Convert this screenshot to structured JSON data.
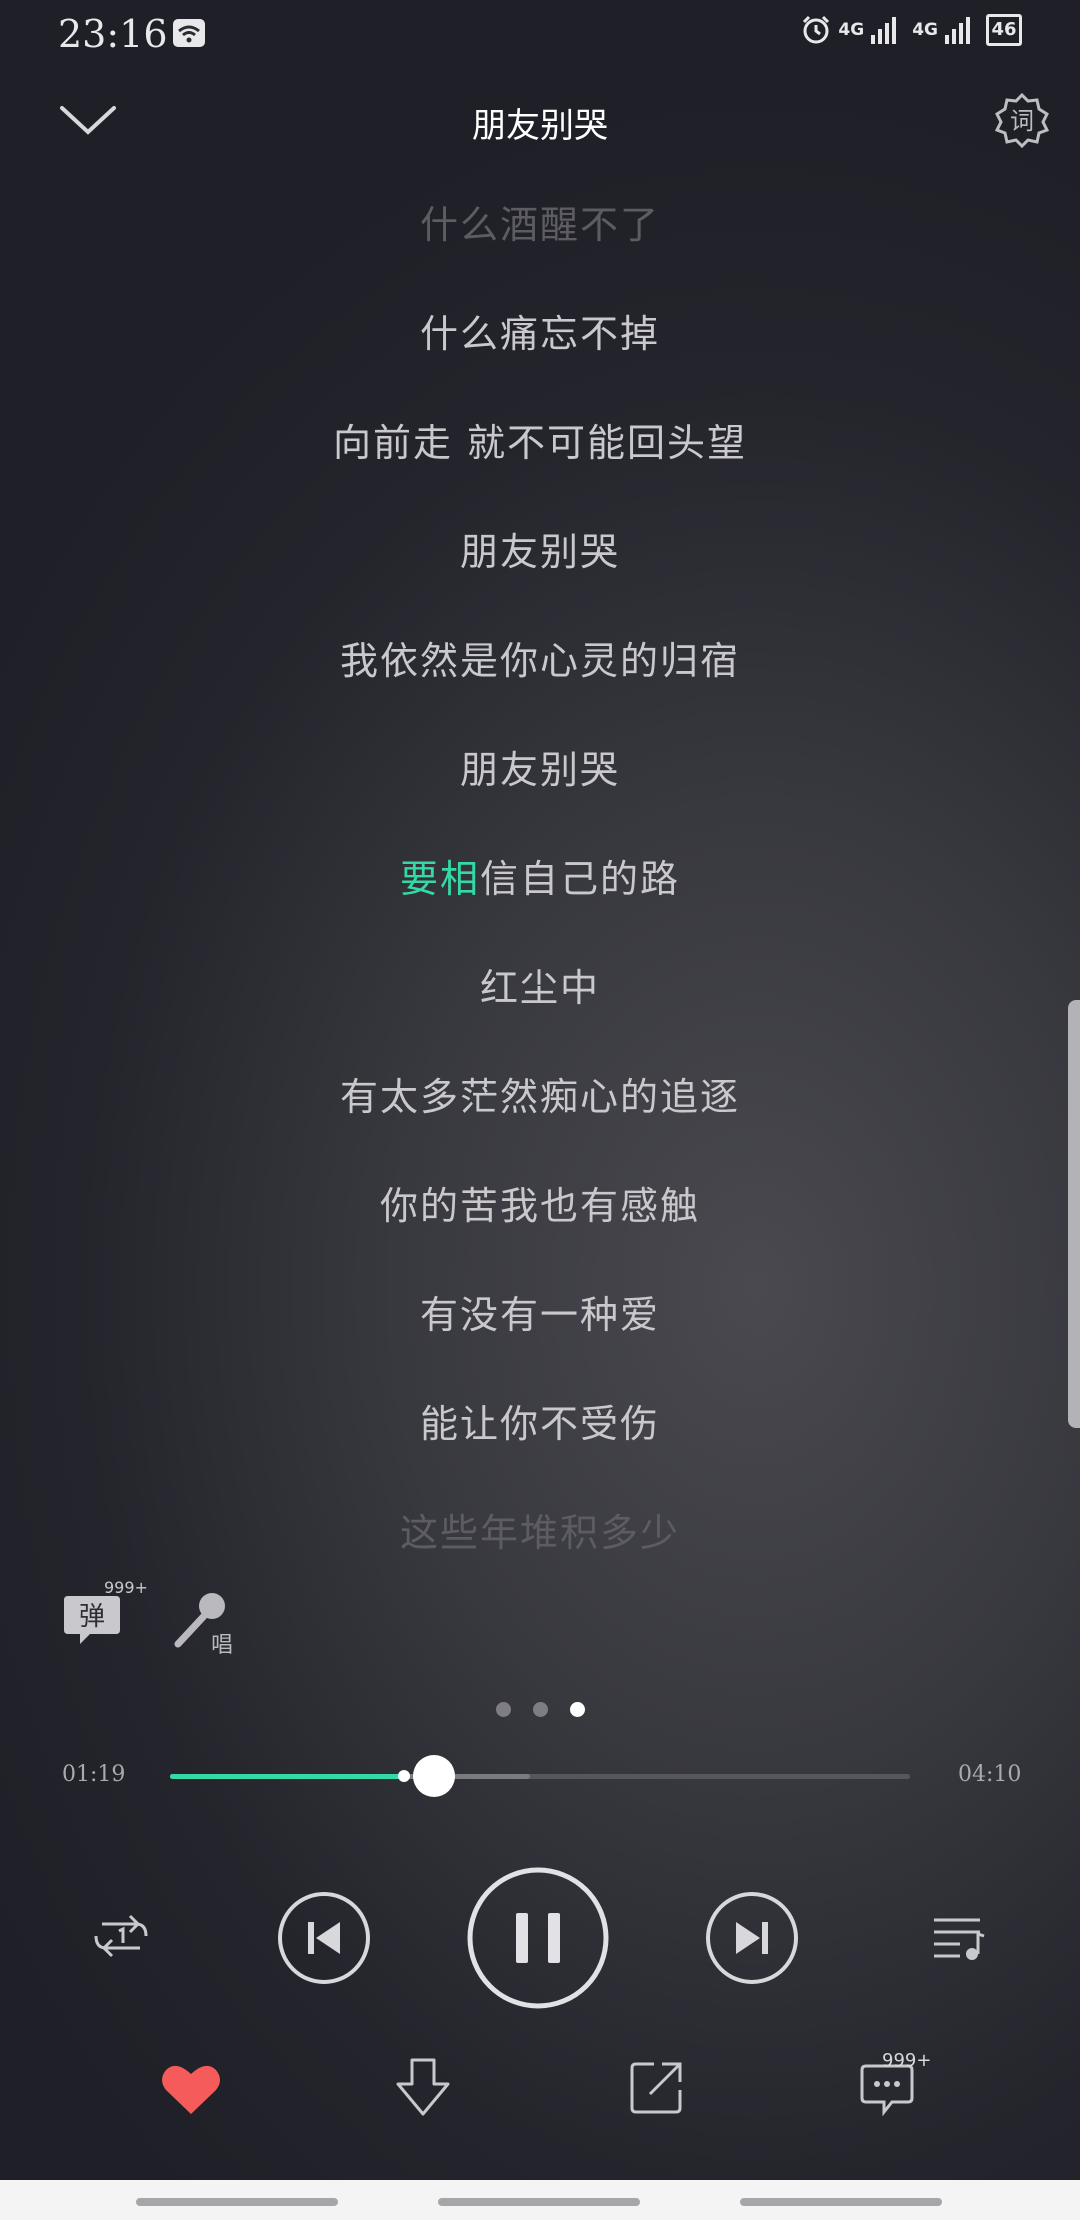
{
  "status_bar": {
    "time": "23:16",
    "network_1": "4G",
    "network_2": "4G",
    "battery": "46"
  },
  "header": {
    "title": "朋友别哭",
    "lyric_settings_label": "词"
  },
  "lyrics": {
    "lines": [
      "什么酒醒不了",
      "什么痛忘不掉",
      "向前走 就不可能回头望",
      "朋友别哭",
      "我依然是你心灵的归宿",
      "朋友别哭",
      "自己的路",
      "红尘中",
      "有太多茫然痴心的追逐",
      "你的苦我也有感触",
      "有没有一种爱",
      "能让你不受伤",
      "这些年堆积多少"
    ],
    "current_sung": "要相",
    "current_pending": "信"
  },
  "tools": {
    "danmaku_label": "弹",
    "danmaku_count": "999+",
    "sing_label": "唱"
  },
  "player": {
    "time_current": "01:19",
    "time_total": "04:10",
    "progress": 0.316,
    "buffered": 0.486,
    "page_count": 3,
    "page_active": 3
  },
  "actions": {
    "comment_count": "999+"
  },
  "colors": {
    "accent": "#35d9a6",
    "like": "#f55b5b"
  }
}
